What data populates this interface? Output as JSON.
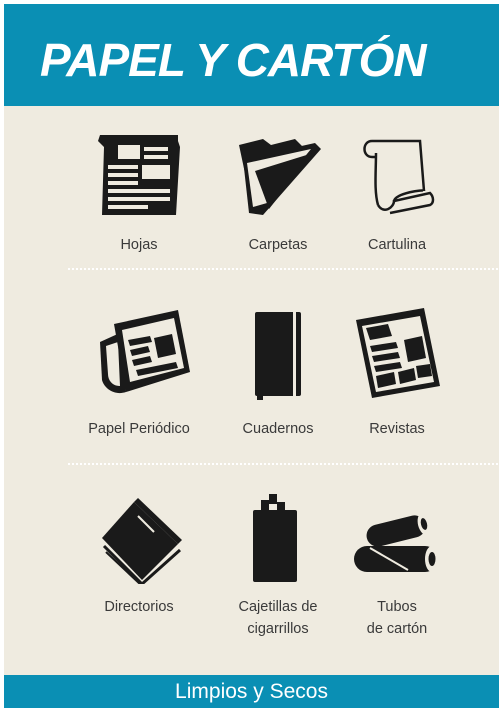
{
  "header": {
    "title": "PAPEL Y CARTÓN"
  },
  "items": [
    {
      "label": "Hojas",
      "icon": "paper-sheet-icon"
    },
    {
      "label": "Carpetas",
      "icon": "folder-icon"
    },
    {
      "label": "Cartulina",
      "icon": "scroll-icon"
    },
    {
      "label": "Papel Periódico",
      "icon": "newspaper-icon"
    },
    {
      "label": "Cuadernos",
      "icon": "notebook-icon"
    },
    {
      "label": "Revistas",
      "icon": "magazine-icon"
    },
    {
      "label": "Directorios",
      "icon": "directory-book-icon"
    },
    {
      "label_line1": "Cajetillas de",
      "label_line2": "cigarrillos",
      "icon": "cigarette-pack-icon"
    },
    {
      "label_line1": "Tubos",
      "label_line2": "de cartón",
      "icon": "cardboard-tubes-icon"
    }
  ],
  "footer": {
    "text": "Limpios y Secos"
  },
  "colors": {
    "accent": "#0a8fb4",
    "background": "#efebe0",
    "icon": "#1a1a1a",
    "label": "#3a3a3a"
  }
}
